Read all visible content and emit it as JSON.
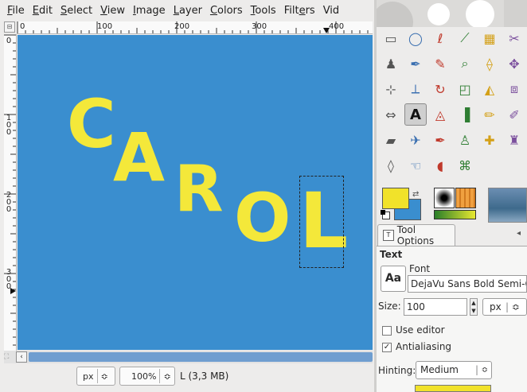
{
  "menubar": {
    "items": [
      {
        "pre": "",
        "u": "F",
        "post": "ile"
      },
      {
        "pre": "",
        "u": "E",
        "post": "dit"
      },
      {
        "pre": "",
        "u": "S",
        "post": "elect"
      },
      {
        "pre": "",
        "u": "V",
        "post": "iew"
      },
      {
        "pre": "",
        "u": "I",
        "post": "mage"
      },
      {
        "pre": "",
        "u": "L",
        "post": "ayer"
      },
      {
        "pre": "",
        "u": "C",
        "post": "olors"
      },
      {
        "pre": "",
        "u": "T",
        "post": "ools"
      },
      {
        "pre": "Filt",
        "u": "e",
        "post": "rs"
      },
      {
        "pre": "Vid",
        "u": "",
        "post": ""
      }
    ]
  },
  "ruler": {
    "h_labels": [
      "0",
      "100",
      "200",
      "300",
      "400"
    ],
    "v_labels": [
      "0",
      "100",
      "200",
      "300"
    ]
  },
  "canvas": {
    "text_letters": [
      "C",
      "A",
      "R",
      "O",
      "L"
    ],
    "bg_color": "#3a8ecf",
    "text_color": "#f4e83a"
  },
  "statusbar": {
    "unit": "px",
    "zoom": "100%",
    "status": "L (3,3 MB)"
  },
  "toolbox": {
    "icons": [
      "rect-select-icon",
      "ellipse-select-icon",
      "free-select-icon",
      "fuzzy-select-icon",
      "color-select-icon",
      "scissors-icon",
      "foreground-select-icon",
      "paths-icon",
      "color-picker-icon",
      "zoom-icon",
      "measure-icon",
      "move-icon",
      "align-icon",
      "crop-icon",
      "rotate-icon",
      "scale-icon",
      "shear-icon",
      "perspective-icon",
      "flip-icon",
      "text-icon",
      "cage-transform-icon",
      "bucket-fill-icon",
      "pencil-icon",
      "paintbrush-icon",
      "eraser-icon",
      "airbrush-icon",
      "ink-icon",
      "clone-icon",
      "heal-icon",
      "perspective-clone-icon",
      "blur-icon",
      "smudge-icon",
      "dodge-burn-icon",
      "unified-transform-icon"
    ],
    "fg_color": "#f1e22a",
    "bg_color": "#3a8ecf"
  },
  "tool_options": {
    "tab_label": "Tool Options",
    "section_title": "Text",
    "font_button": "Aa",
    "font_label": "Font",
    "font_value": "DejaVu Sans Bold Semi-Con",
    "size_label": "Size:",
    "size_value": "100",
    "size_unit": "px",
    "use_editor_label": "Use editor",
    "use_editor_checked": false,
    "antialiasing_label": "Antialiasing",
    "antialiasing_checked": true,
    "hinting_label": "Hinting:",
    "hinting_value": "Medium"
  }
}
